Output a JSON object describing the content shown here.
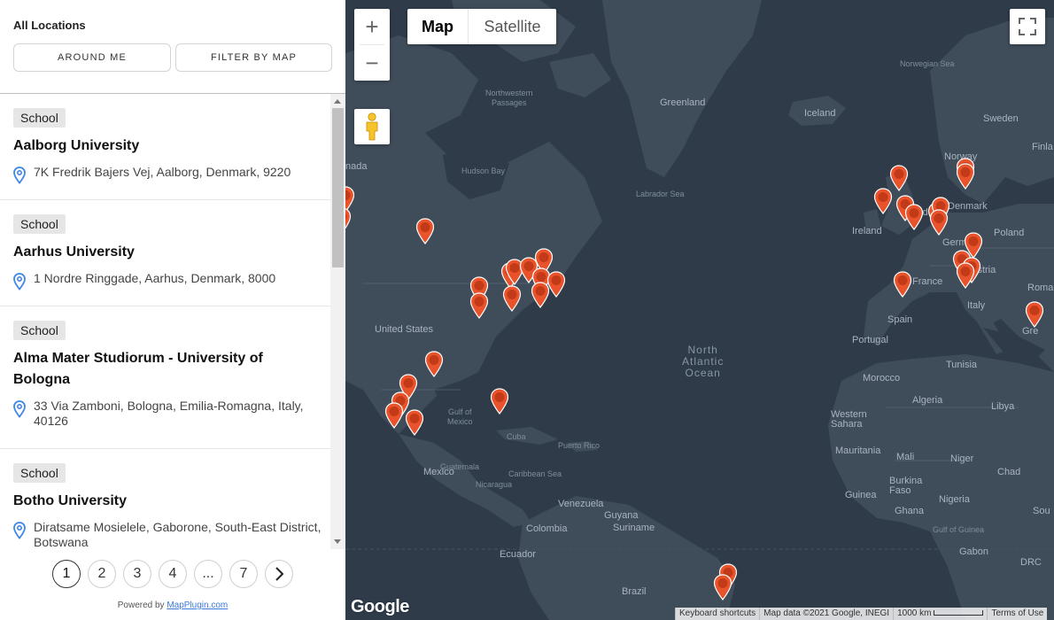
{
  "sidebar": {
    "title": "All Locations",
    "around_me_label": "AROUND ME",
    "filter_by_map_label": "FILTER BY MAP",
    "locations": [
      {
        "category": "School",
        "name": "Aalborg University",
        "address": "7K Fredrik Bajers Vej, Aalborg, Denmark, 9220"
      },
      {
        "category": "School",
        "name": "Aarhus University",
        "address": "1 Nordre Ringgade, Aarhus, Denmark, 8000"
      },
      {
        "category": "School",
        "name": "Alma Mater Studiorum - University of Bologna",
        "address": "33 Via Zamboni, Bologna, Emilia-Romagna, Italy, 40126"
      },
      {
        "category": "School",
        "name": "Botho University",
        "address": "Diratsame Mosielele, Gaborone, South-East District, Botswana"
      }
    ],
    "pagination": {
      "pages": [
        "1",
        "2",
        "3",
        "4",
        "...",
        "7"
      ],
      "current": "1",
      "next_icon": "chevron-right-icon"
    },
    "powered_by": "Powered by",
    "powered_by_link": "MapPlugin.com"
  },
  "map": {
    "zoom_in": "+",
    "zoom_out": "−",
    "type_map": "Map",
    "type_satellite": "Satellite",
    "labels": {
      "greenland": "Greenland",
      "iceland": "Iceland",
      "norwegian_sea": "Norwegian Sea",
      "northwestern_passages": "Northwestern\nPassages",
      "sweden": "Sweden",
      "finland": "Finla",
      "norway": "Norway",
      "hudson_bay": "Hudson Bay",
      "labrador_sea": "Labrador Sea",
      "canada": "nada",
      "denmark": "Denmark",
      "ireland": "Ireland",
      "united_kingdom": "United",
      "germany": "Germany",
      "poland": "Poland",
      "austria": "Austria",
      "france": "France",
      "romania": "Romani",
      "italy": "Italy",
      "spain": "Spain",
      "portugal": "Portugal",
      "greece": "Gre",
      "united_states": "United States",
      "north_atlantic": "North\nAtlantic\nOcean",
      "tunisia": "Tunisia",
      "morocco": "Morocco",
      "algeria": "Algeria",
      "libya": "Libya",
      "gulf_of_mexico": "Gulf of\nMexico",
      "cuba": "Cuba",
      "western_sahara": "Western\nSahara",
      "puerto_rico": "Puerto Rico",
      "mexico": "Mexico",
      "mauritania": "Mauritania",
      "mali": "Mali",
      "niger": "Niger",
      "chad": "Chad",
      "guatemala": "Guatemala",
      "caribbean_sea": "Caribbean Sea",
      "nicaragua": "Nicaragua",
      "burkina_faso": "Burkina\nFaso",
      "guinea": "Guinea",
      "venezuela": "Venezuela",
      "guyana": "Guyana",
      "suriname": "Suriname",
      "ghana": "Ghana",
      "nigeria": "Nigeria",
      "colombia": "Colombia",
      "gulf_of_guinea": "Gulf of Guinea",
      "ecuador": "Ecuador",
      "gabon": "Gabon",
      "drc": "DRC",
      "sudan": "Sou",
      "brazil": "Brazil"
    },
    "google_logo": "Google",
    "attribution": {
      "keyboard_shortcuts": "Keyboard shortcuts",
      "map_data": "Map data ©2021 Google, INEGI",
      "scale": "1000 km",
      "terms": "Terms of Use"
    },
    "pin_color": "#e8532b",
    "water_color": "#2f3b49",
    "land_color": "#3f4c5a"
  }
}
